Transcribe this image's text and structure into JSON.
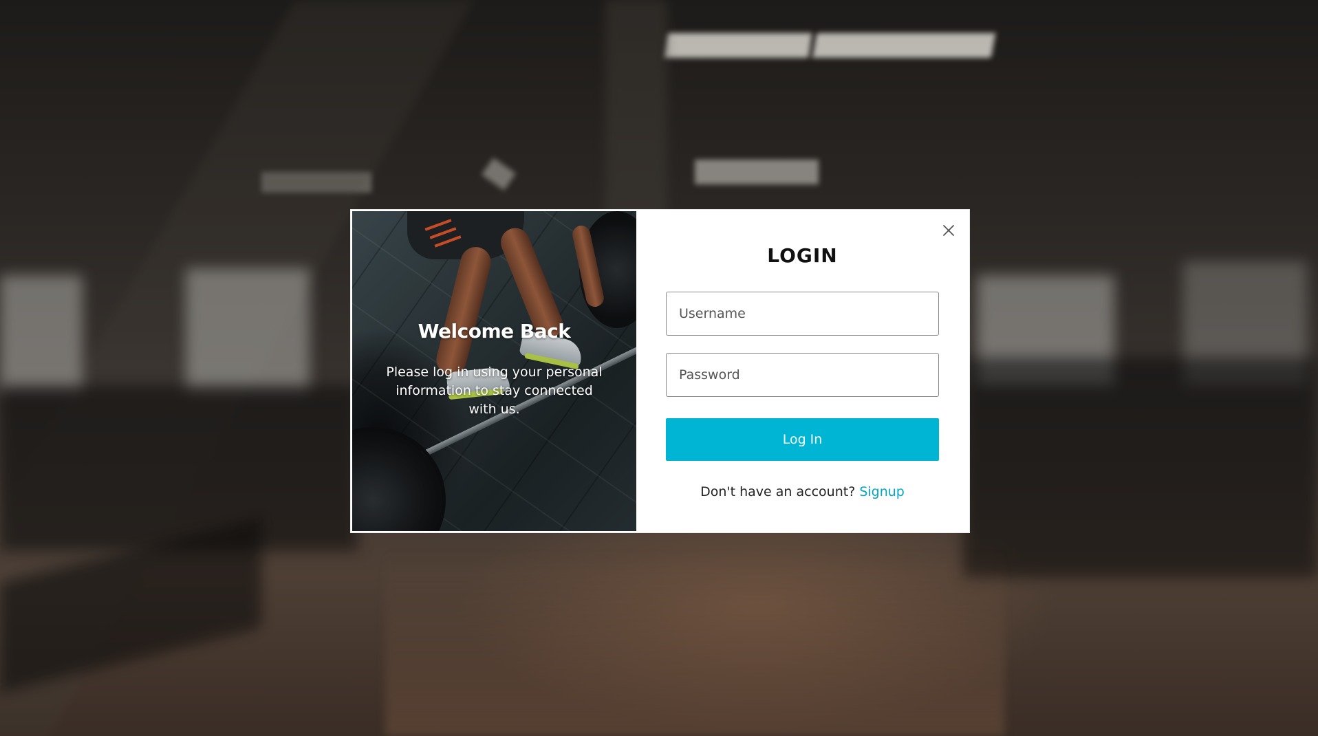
{
  "hero": {
    "title": "Welcome Back",
    "body": "Please log in using your personal information to stay connected with us."
  },
  "form": {
    "title": "LOGIN",
    "username_placeholder": "Username",
    "password_placeholder": "Password",
    "submit_label": "Log In",
    "signup_prompt": "Don't have an account?",
    "signup_link": "Signup"
  },
  "icons": {
    "close": "close-icon"
  },
  "colors": {
    "primary_button": "#00b5d4",
    "link": "#00a7c7",
    "modal_background": "#ffffff"
  }
}
